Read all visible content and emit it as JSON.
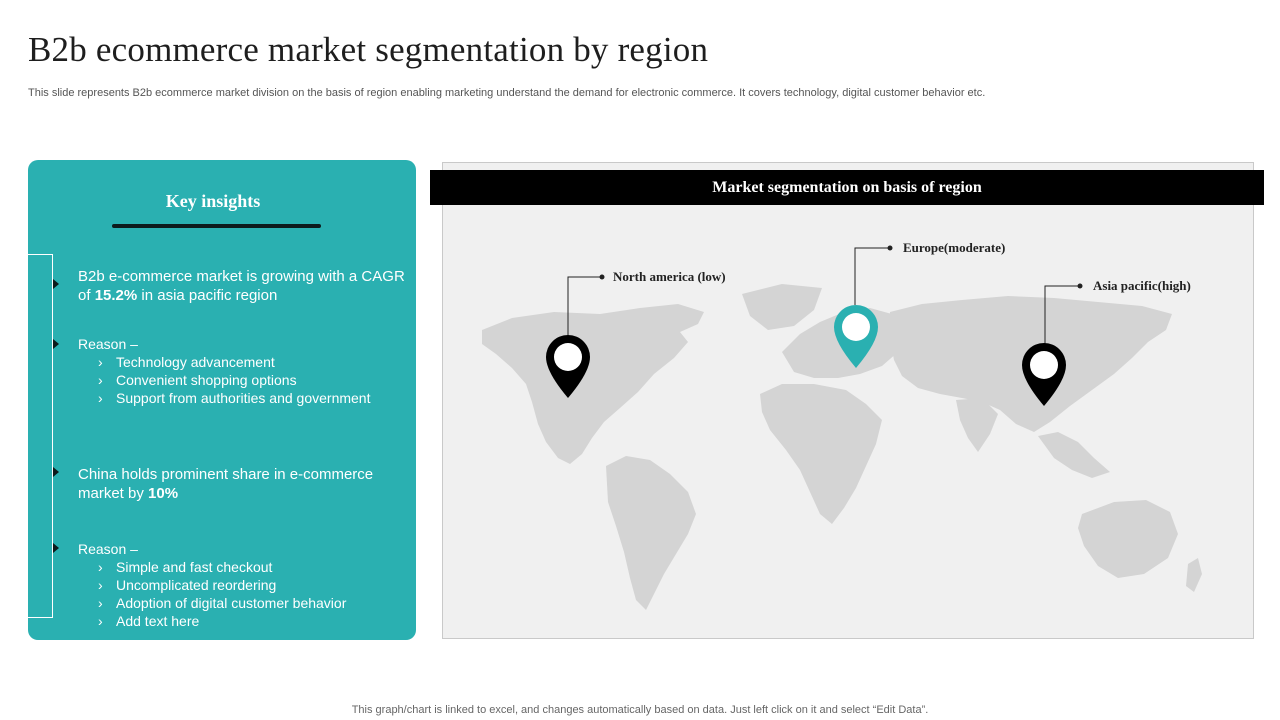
{
  "slide": {
    "title": "B2b ecommerce market segmentation by region",
    "subtitle": "This slide represents B2b ecommerce market division on the basis of region enabling marketing understand the demand for electronic commerce. It covers technology, digital customer behavior etc.",
    "footnote": "This graph/chart is linked to excel, and changes automatically based on data. Just left click on it and select “Edit Data”."
  },
  "insights": {
    "heading": "Key insights",
    "points": [
      {
        "pre": "B2b e-commerce market is growing with a CAGR of ",
        "bold": "15.2%",
        "post": " in asia pacific region"
      },
      {
        "pre": "China holds prominent share in e-commerce market by ",
        "bold": "10%",
        "post": ""
      }
    ],
    "reasons": [
      {
        "label": "Reason –",
        "items": [
          "Technology advancement",
          "Convenient shopping options",
          "Support from authorities and government"
        ]
      },
      {
        "label": "Reason –",
        "items": [
          "Simple and fast checkout",
          "Uncomplicated reordering",
          "Adoption of digital customer behavior",
          "Add text here"
        ]
      }
    ]
  },
  "map": {
    "header": "Market segmentation on basis of region",
    "pins": [
      {
        "label": "North america (low)",
        "color": "#000000"
      },
      {
        "label": "Europe(moderate)",
        "color": "#2ab0b1"
      },
      {
        "label": "Asia pacific(high)",
        "color": "#000000"
      }
    ]
  },
  "colors": {
    "accent": "#2ab0b1",
    "dark": "#000000",
    "map_land": "#d4d4d4",
    "map_bg": "#f0f0f0"
  }
}
